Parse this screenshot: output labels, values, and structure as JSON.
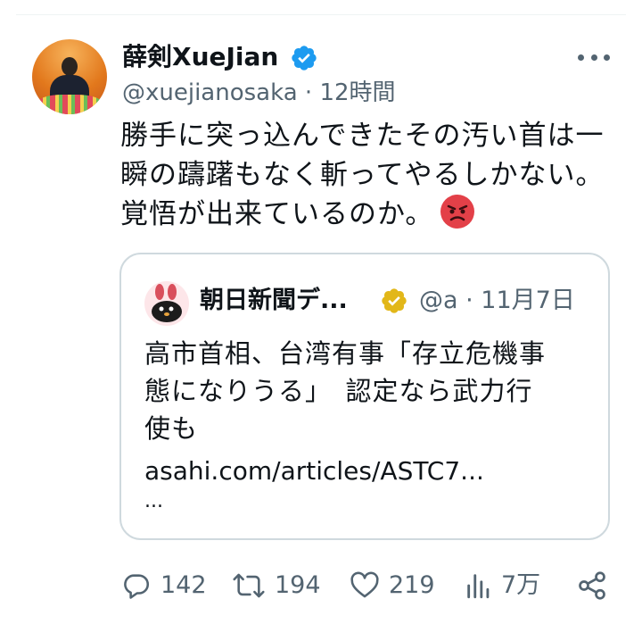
{
  "tweet": {
    "display_name": "薛剣XueJian",
    "handle": "@xuejianosaka",
    "separator": " · ",
    "time": "12時間",
    "text_lines": [
      "勝手に突っ込んできたその汚い首は一",
      "瞬の躊躇もなく斬ってやるしかない。",
      "覚悟が出来ているのか。"
    ],
    "emoji": "angry-face-icon"
  },
  "quote": {
    "display_name": "朝日新聞デ...",
    "handle": "@a",
    "separator": " · ",
    "date": "11月7日",
    "text_lines": [
      "高市首相、台湾有事「存立危機事",
      "態になりうる」　認定なら武力行",
      "使も"
    ],
    "link": "asahi.com/articles/ASTC7...",
    "ellipsis": "..."
  },
  "actions": {
    "replies": "142",
    "reposts": "194",
    "likes": "219",
    "views": "7万"
  },
  "colors": {
    "verified_blue": "#1d9bf0",
    "verified_gold": "#e2b719",
    "secondary_text": "#536471",
    "angry_red": "#e34048"
  }
}
